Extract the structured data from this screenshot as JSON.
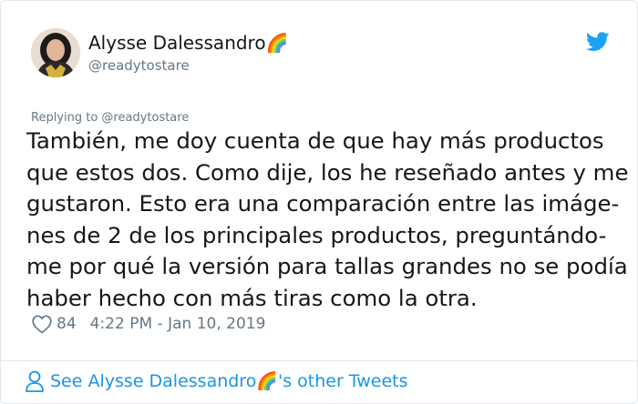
{
  "author": {
    "display_name": "Alysse Dalessandro🌈",
    "handle": "@readytostare"
  },
  "reply_context": "Replying to @readytostare",
  "tweet_lines": [
    "También, me doy cuenta de que hay más productos",
    "que estos dos. Como dije, los he reseñado antes y me",
    "gustaron. Esto era una comparación entre las imáge-",
    "nes de 2 de los principales productos, preguntándo-",
    "me por qué la versión para tallas grandes no se podía",
    "haber hecho con más tiras como la otra."
  ],
  "meta": {
    "likes": "84",
    "timestamp": "4:22 PM - Jan 10, 2019"
  },
  "footer": {
    "see_more": "See Alysse Dalessandro🌈's other Tweets"
  },
  "icons": {
    "brand": "twitter-bird-icon",
    "like": "heart-icon",
    "profile": "person-icon"
  },
  "colors": {
    "twitter_blue": "#1da1f2",
    "link_blue": "#1b95e0",
    "text": "#14171a",
    "muted": "#657786",
    "border": "#e1e8ed"
  }
}
